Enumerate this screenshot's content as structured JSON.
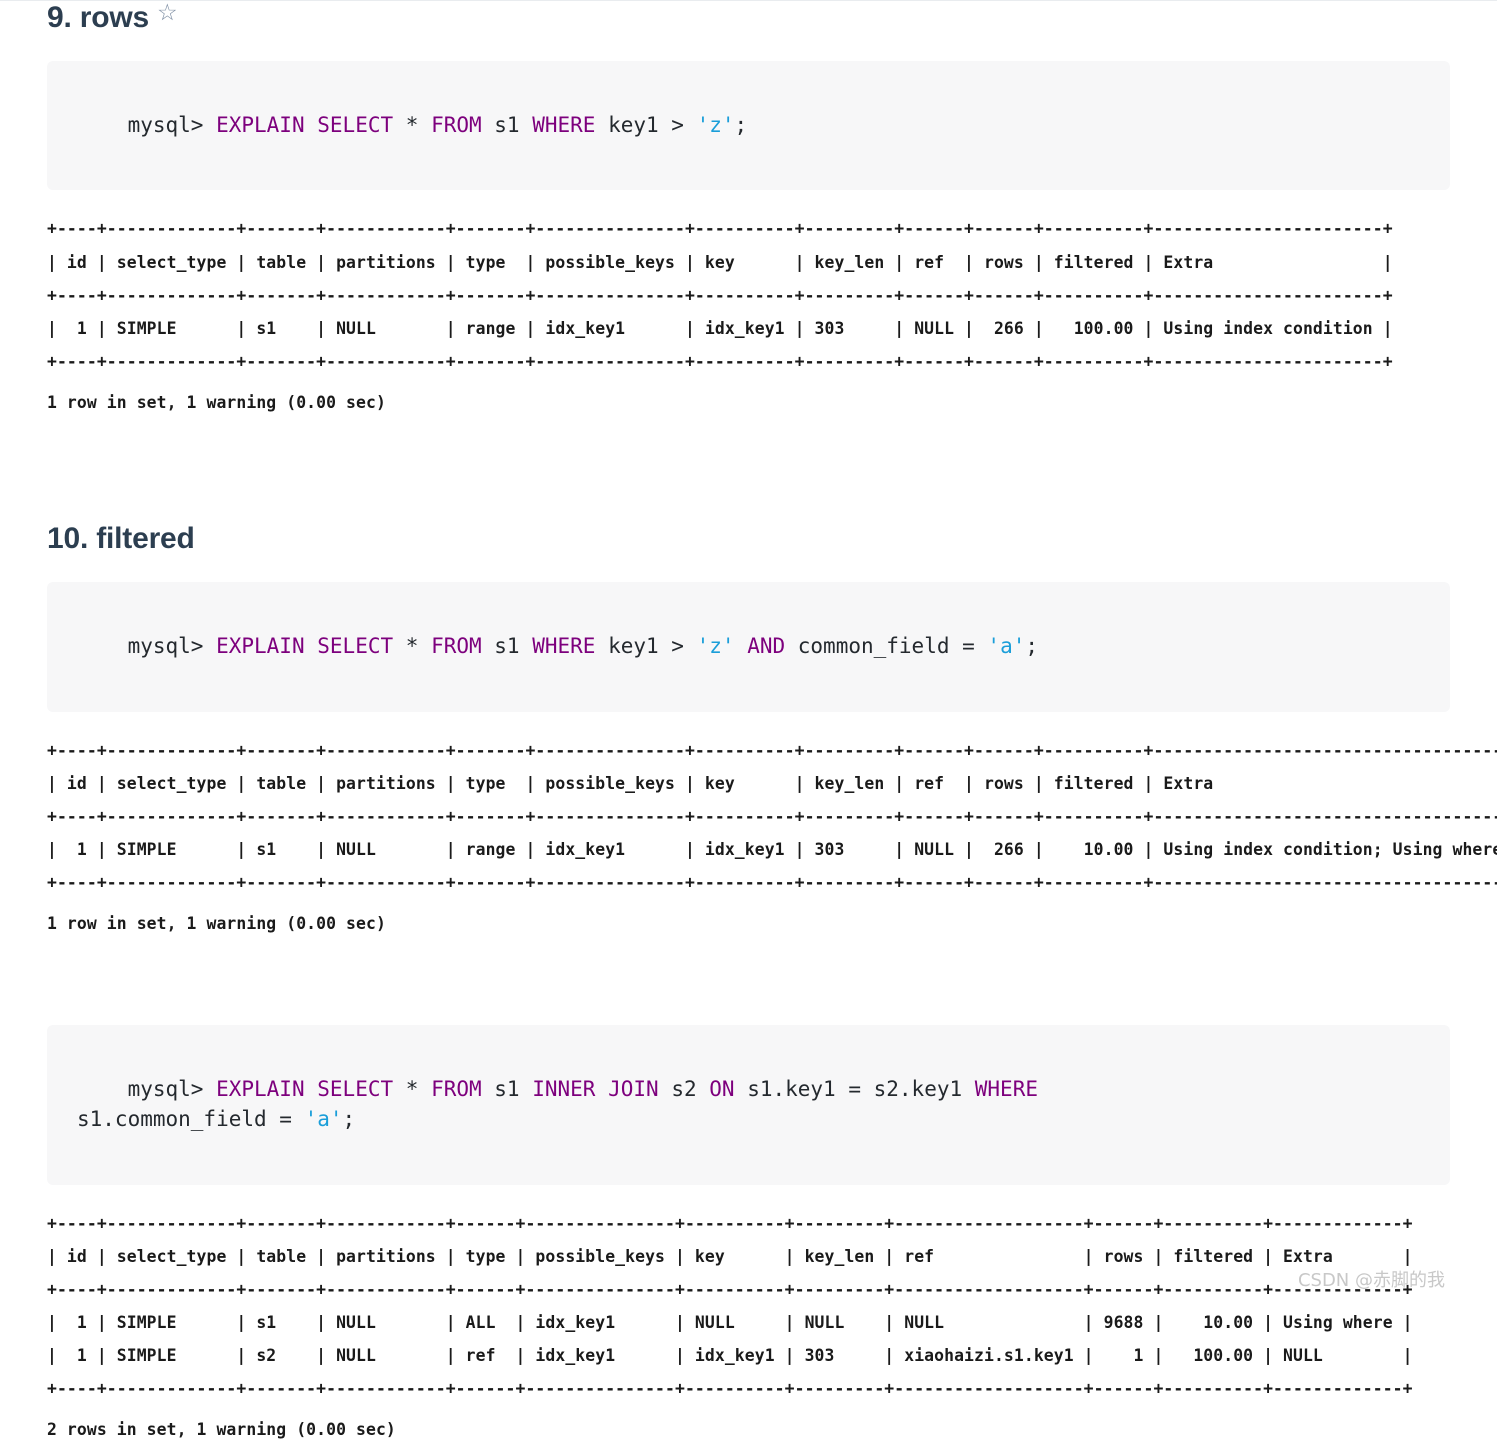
{
  "sections": [
    {
      "heading": "9. rows",
      "heading_star": "☆",
      "query": {
        "prompt": "mysql> ",
        "tokens": [
          {
            "t": "EXPLAIN",
            "k": "kw"
          },
          {
            "t": " ",
            "k": "pl"
          },
          {
            "t": "SELECT",
            "k": "kw"
          },
          {
            "t": " * ",
            "k": "pl"
          },
          {
            "t": "FROM",
            "k": "kw"
          },
          {
            "t": " s1 ",
            "k": "pl"
          },
          {
            "t": "WHERE",
            "k": "kw"
          },
          {
            "t": " key1 > ",
            "k": "pl"
          },
          {
            "t": "'z'",
            "k": "str"
          },
          {
            "t": ";",
            "k": "pl"
          }
        ],
        "plain": "mysql> EXPLAIN SELECT * FROM s1 WHERE key1 > 'z';"
      },
      "result": "+----+-------------+-------+------------+-------+---------------+----------+---------+------+------+----------+-----------------------+\n| id | select_type | table | partitions | type  | possible_keys | key      | key_len | ref  | rows | filtered | Extra                 |\n+----+-------------+-------+------------+-------+---------------+----------+---------+------+------+----------+-----------------------+\n|  1 | SIMPLE      | s1    | NULL       | range | idx_key1      | idx_key1 | 303     | NULL |  266 |   100.00 | Using index condition |\n+----+-------------+-------+------------+-------+---------------+----------+---------+------+------+----------+-----------------------+",
      "footer": "1 row in set, 1 warning (0.00 sec)"
    },
    {
      "heading": "10. filtered",
      "heading_star": "",
      "query": {
        "prompt": "mysql> ",
        "tokens": [
          {
            "t": "EXPLAIN",
            "k": "kw"
          },
          {
            "t": " ",
            "k": "pl"
          },
          {
            "t": "SELECT",
            "k": "kw"
          },
          {
            "t": " * ",
            "k": "pl"
          },
          {
            "t": "FROM",
            "k": "kw"
          },
          {
            "t": " s1 ",
            "k": "pl"
          },
          {
            "t": "WHERE",
            "k": "kw"
          },
          {
            "t": " key1 > ",
            "k": "pl"
          },
          {
            "t": "'z'",
            "k": "str"
          },
          {
            "t": " ",
            "k": "pl"
          },
          {
            "t": "AND",
            "k": "kw"
          },
          {
            "t": " common_field = ",
            "k": "pl"
          },
          {
            "t": "'a'",
            "k": "str"
          },
          {
            "t": ";",
            "k": "pl"
          }
        ],
        "plain": "mysql> EXPLAIN SELECT * FROM s1 WHERE key1 > 'z' AND common_field = 'a';"
      },
      "result": "+----+-------------+-------+------------+-------+---------------+----------+---------+------+------+----------+------------------------------------+\n| id | select_type | table | partitions | type  | possible_keys | key      | key_len | ref  | rows | filtered | Extra                              |\n+----+-------------+-------+------------+-------+---------------+----------+---------+------+------+----------+------------------------------------+\n|  1 | SIMPLE      | s1    | NULL       | range | idx_key1      | idx_key1 | 303     | NULL |  266 |    10.00 | Using index condition; Using where |\n+----+-------------+-------+------------+-------+---------------+----------+---------+------+------+----------+------------------------------------+",
      "footer": "1 row in set, 1 warning (0.00 sec)"
    },
    {
      "heading": "",
      "heading_star": "",
      "query": {
        "prompt": "mysql> ",
        "tokens": [
          {
            "t": "EXPLAIN",
            "k": "kw"
          },
          {
            "t": " ",
            "k": "pl"
          },
          {
            "t": "SELECT",
            "k": "kw"
          },
          {
            "t": " * ",
            "k": "pl"
          },
          {
            "t": "FROM",
            "k": "kw"
          },
          {
            "t": " s1 ",
            "k": "pl"
          },
          {
            "t": "INNER",
            "k": "kw"
          },
          {
            "t": " ",
            "k": "pl"
          },
          {
            "t": "JOIN",
            "k": "kw"
          },
          {
            "t": " s2 ",
            "k": "pl"
          },
          {
            "t": "ON",
            "k": "kw"
          },
          {
            "t": " s1.key1 = s2.key1 ",
            "k": "pl"
          },
          {
            "t": "WHERE",
            "k": "kw"
          },
          {
            "t": "\ns1.common_field = ",
            "k": "pl"
          },
          {
            "t": "'a'",
            "k": "str"
          },
          {
            "t": ";",
            "k": "pl"
          }
        ],
        "plain": "mysql> EXPLAIN SELECT * FROM s1 INNER JOIN s2 ON s1.key1 = s2.key1 WHERE s1.common_field = 'a';"
      },
      "result": "+----+-------------+-------+------------+------+---------------+----------+---------+-------------------+------+----------+-------------+\n| id | select_type | table | partitions | type | possible_keys | key      | key_len | ref               | rows | filtered | Extra       |\n+----+-------------+-------+------------+------+---------------+----------+---------+-------------------+------+----------+-------------+\n|  1 | SIMPLE      | s1    | NULL       | ALL  | idx_key1      | NULL     | NULL    | NULL              | 9688 |    10.00 | Using where |\n|  1 | SIMPLE      | s2    | NULL       | ref  | idx_key1      | idx_key1 | 303     | xiaohaizi.s1.key1 |    1 |   100.00 | NULL        |\n+----+-------------+-------+------------+------+---------------+----------+---------+-------------------+------+----------+-------------+",
      "footer": "2 rows in set, 1 warning (0.00 sec)"
    }
  ],
  "explain_tables": [
    {
      "columns": [
        "id",
        "select_type",
        "table",
        "partitions",
        "type",
        "possible_keys",
        "key",
        "key_len",
        "ref",
        "rows",
        "filtered",
        "Extra"
      ],
      "rows": [
        [
          "1",
          "SIMPLE",
          "s1",
          "NULL",
          "range",
          "idx_key1",
          "idx_key1",
          "303",
          "NULL",
          "266",
          "100.00",
          "Using index condition"
        ]
      ]
    },
    {
      "columns": [
        "id",
        "select_type",
        "table",
        "partitions",
        "type",
        "possible_keys",
        "key",
        "key_len",
        "ref",
        "rows",
        "filtered",
        "Extra"
      ],
      "rows": [
        [
          "1",
          "SIMPLE",
          "s1",
          "NULL",
          "range",
          "idx_key1",
          "idx_key1",
          "303",
          "NULL",
          "266",
          "10.00",
          "Using index condition; Using where"
        ]
      ]
    },
    {
      "columns": [
        "id",
        "select_type",
        "table",
        "partitions",
        "type",
        "possible_keys",
        "key",
        "key_len",
        "ref",
        "rows",
        "filtered",
        "Extra"
      ],
      "rows": [
        [
          "1",
          "SIMPLE",
          "s1",
          "NULL",
          "ALL",
          "idx_key1",
          "NULL",
          "NULL",
          "NULL",
          "9688",
          "10.00",
          "Using where"
        ],
        [
          "1",
          "SIMPLE",
          "s2",
          "NULL",
          "ref",
          "idx_key1",
          "idx_key1",
          "303",
          "xiaohaizi.s1.key1",
          "1",
          "100.00",
          "NULL"
        ]
      ]
    }
  ],
  "watermark": "CSDN @赤脚的我",
  "colors": {
    "keyword": "#7d007d",
    "string": "#1a9ed9",
    "heading": "#2c3e50",
    "code_bg": "#f7f7f8",
    "watermark": "#c8c8c8"
  }
}
